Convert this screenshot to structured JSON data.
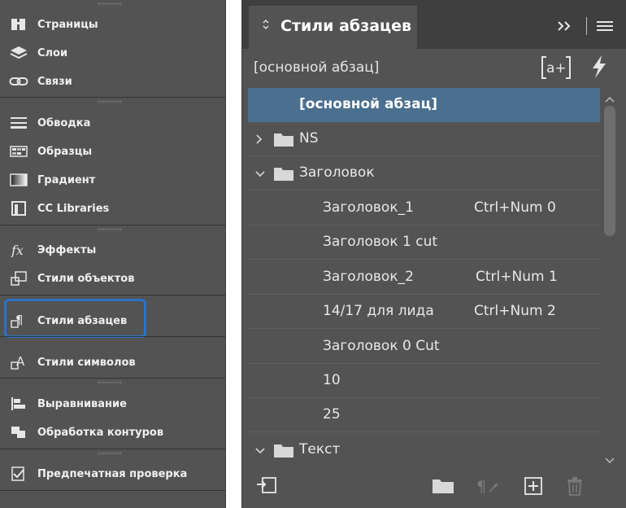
{
  "dock": {
    "items": [
      {
        "label": "Страницы",
        "icon": "pages-icon"
      },
      {
        "label": "Слои",
        "icon": "layers-icon"
      },
      {
        "label": "Связи",
        "icon": "links-icon"
      },
      {
        "label": "Обводка",
        "icon": "stroke-icon"
      },
      {
        "label": "Образцы",
        "icon": "swatches-icon"
      },
      {
        "label": "Градиент",
        "icon": "gradient-icon"
      },
      {
        "label": "CC Libraries",
        "icon": "cc-libraries-icon"
      },
      {
        "label": "Эффекты",
        "icon": "effects-icon"
      },
      {
        "label": "Стили объектов",
        "icon": "object-styles-icon"
      },
      {
        "label": "Стили абзацев",
        "icon": "paragraph-styles-icon"
      },
      {
        "label": "Стили символов",
        "icon": "character-styles-icon"
      },
      {
        "label": "Выравнивание",
        "icon": "align-icon"
      },
      {
        "label": "Обработка контуров",
        "icon": "pathfinder-icon"
      },
      {
        "label": "Предпечатная проверка",
        "icon": "preflight-icon"
      }
    ],
    "highlight_color": "#2d73c4"
  },
  "panel": {
    "title": "Стили абзацев",
    "current_style": "[основной абзац]",
    "rows": [
      {
        "name": "[основной абзац]",
        "shortcut": "",
        "type": "style",
        "selected": true
      },
      {
        "name": "NS",
        "shortcut": "",
        "type": "folder",
        "expanded": false
      },
      {
        "name": "Заголовок",
        "shortcut": "",
        "type": "folder",
        "expanded": true
      },
      {
        "name": "Заголовок_1",
        "shortcut": "Ctrl+Num 0",
        "type": "style"
      },
      {
        "name": "Заголовок 1 cut",
        "shortcut": "",
        "type": "style"
      },
      {
        "name": "Заголовок_2",
        "shortcut": "Ctrl+Num 1",
        "type": "style"
      },
      {
        "name": "14/17 для лида",
        "shortcut": "Ctrl+Num 2",
        "type": "style"
      },
      {
        "name": "Заголовок 0 Cut",
        "shortcut": "",
        "type": "style"
      },
      {
        "name": "10",
        "shortcut": "",
        "type": "style"
      },
      {
        "name": "25",
        "shortcut": "",
        "type": "style"
      },
      {
        "name": "Текст",
        "shortcut": "",
        "type": "folder",
        "expanded": true
      }
    ],
    "selected_color": "#4b6f8f"
  }
}
